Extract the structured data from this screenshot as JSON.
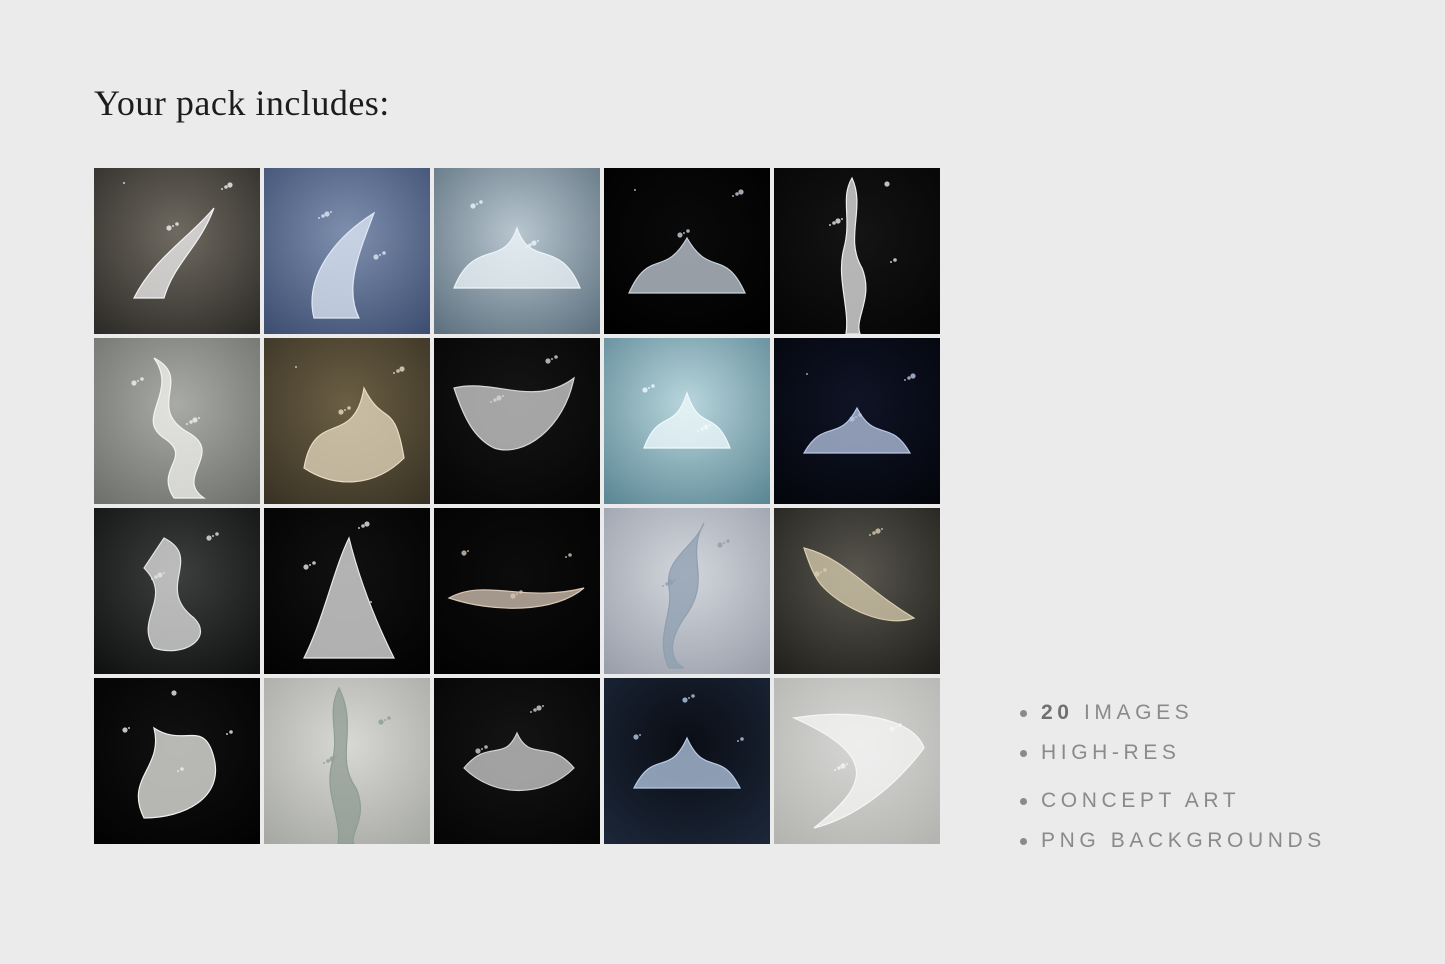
{
  "header": {
    "title": "Your pack includes:"
  },
  "gallery": {
    "tiles": [
      {
        "bg": [
          "#6f6a61",
          "#2e2c28"
        ],
        "splash": "#f2f2f2",
        "icon": "water-splash-icon"
      },
      {
        "bg": [
          "#7e8fae",
          "#3f4f72"
        ],
        "splash": "#dfe8f5",
        "icon": "water-splash-icon"
      },
      {
        "bg": [
          "#b8c6cf",
          "#5f7280"
        ],
        "splash": "#eef5fa",
        "icon": "water-splash-icon"
      },
      {
        "bg": [
          "#0a0a0a",
          "#000000"
        ],
        "splash": "#c9d2dc",
        "icon": "water-splash-icon"
      },
      {
        "bg": [
          "#141414",
          "#050505"
        ],
        "splash": "#eeeeee",
        "icon": "water-splash-icon"
      },
      {
        "bg": [
          "#a9aba7",
          "#6f716d"
        ],
        "splash": "#f3f3f0",
        "icon": "water-splash-icon"
      },
      {
        "bg": [
          "#6b5f44",
          "#3a3325"
        ],
        "splash": "#e8dcc2",
        "icon": "water-splash-icon"
      },
      {
        "bg": [
          "#151515",
          "#050505"
        ],
        "splash": "#d7d7d7",
        "icon": "water-splash-icon"
      },
      {
        "bg": [
          "#b9d6dc",
          "#5d8896"
        ],
        "splash": "#f0fafc",
        "icon": "water-splash-icon"
      },
      {
        "bg": [
          "#0f1426",
          "#04060c"
        ],
        "splash": "#b9c7e6",
        "icon": "water-splash-icon"
      },
      {
        "bg": [
          "#3d3f3e",
          "#101211"
        ],
        "splash": "#e5e5e5",
        "icon": "water-splash-icon"
      },
      {
        "bg": [
          "#111111",
          "#020202"
        ],
        "splash": "#e9e9e9",
        "icon": "water-splash-icon"
      },
      {
        "bg": [
          "#0c0c0c",
          "#020202"
        ],
        "splash": "#d8c7b7",
        "icon": "water-splash-icon"
      },
      {
        "bg": [
          "#d3d6dc",
          "#9aa0ab"
        ],
        "splash": "#8e9fb0",
        "icon": "water-splash-icon"
      },
      {
        "bg": [
          "#58564e",
          "#22211d"
        ],
        "splash": "#d9cdb0",
        "icon": "water-splash-icon"
      },
      {
        "bg": [
          "#111111",
          "#020202"
        ],
        "splash": "#f0f0ec",
        "icon": "water-splash-icon"
      },
      {
        "bg": [
          "#d8d8d4",
          "#a7a9a4"
        ],
        "splash": "#8f9c94",
        "icon": "water-splash-icon"
      },
      {
        "bg": [
          "#141414",
          "#050505"
        ],
        "splash": "#d3d3d3",
        "icon": "water-splash-icon"
      },
      {
        "bg": [
          "#0a0d14",
          "#1b2638"
        ],
        "splash": "#b7cbe6",
        "icon": "water-splash-icon"
      },
      {
        "bg": [
          "#d6d6d4",
          "#b4b4b1"
        ],
        "splash": "#f6f6f6",
        "icon": "water-splash-icon"
      }
    ]
  },
  "features": {
    "images_count": "20",
    "images_label": "IMAGES",
    "item2": "HIGH-RES",
    "item3": "CONCEPT ART",
    "item4": "PNG BACKGROUNDS"
  }
}
